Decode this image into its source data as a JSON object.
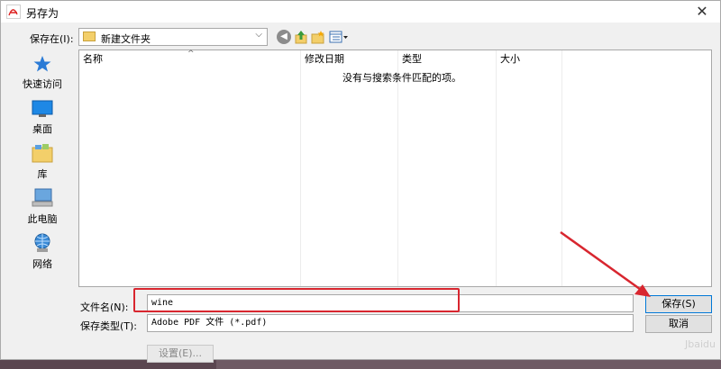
{
  "window": {
    "title": "另存为",
    "close_glyph": "✕"
  },
  "toolbar": {
    "save_in_label": "保存在(I):",
    "folder_name": "新建文件夹",
    "icons": [
      "folder-icon",
      "back-icon",
      "up-folder-icon",
      "new-folder-icon",
      "views-menu-icon"
    ]
  },
  "places": [
    {
      "label": "快速访问",
      "icon": "star-icon"
    },
    {
      "label": "桌面",
      "icon": "desktop-icon"
    },
    {
      "label": "库",
      "icon": "library-icon"
    },
    {
      "label": "此电脑",
      "icon": "computer-icon"
    },
    {
      "label": "网络",
      "icon": "network-icon"
    }
  ],
  "file_list": {
    "columns": [
      "名称",
      "修改日期",
      "类型",
      "大小"
    ],
    "sort_indicator": "^",
    "empty_message": "没有与搜索条件匹配的项。"
  },
  "form": {
    "filename_label": "文件名(N):",
    "filename_value": "wine",
    "filetype_label": "保存类型(T):",
    "filetype_value": "Adobe PDF 文件 (*.pdf)"
  },
  "buttons": {
    "save": "保存(S)",
    "cancel": "取消",
    "settings": "设置(E)..."
  },
  "colors": {
    "annotation": "#d8262f",
    "accent": "#0078d7"
  },
  "watermark": "Jbaidu"
}
